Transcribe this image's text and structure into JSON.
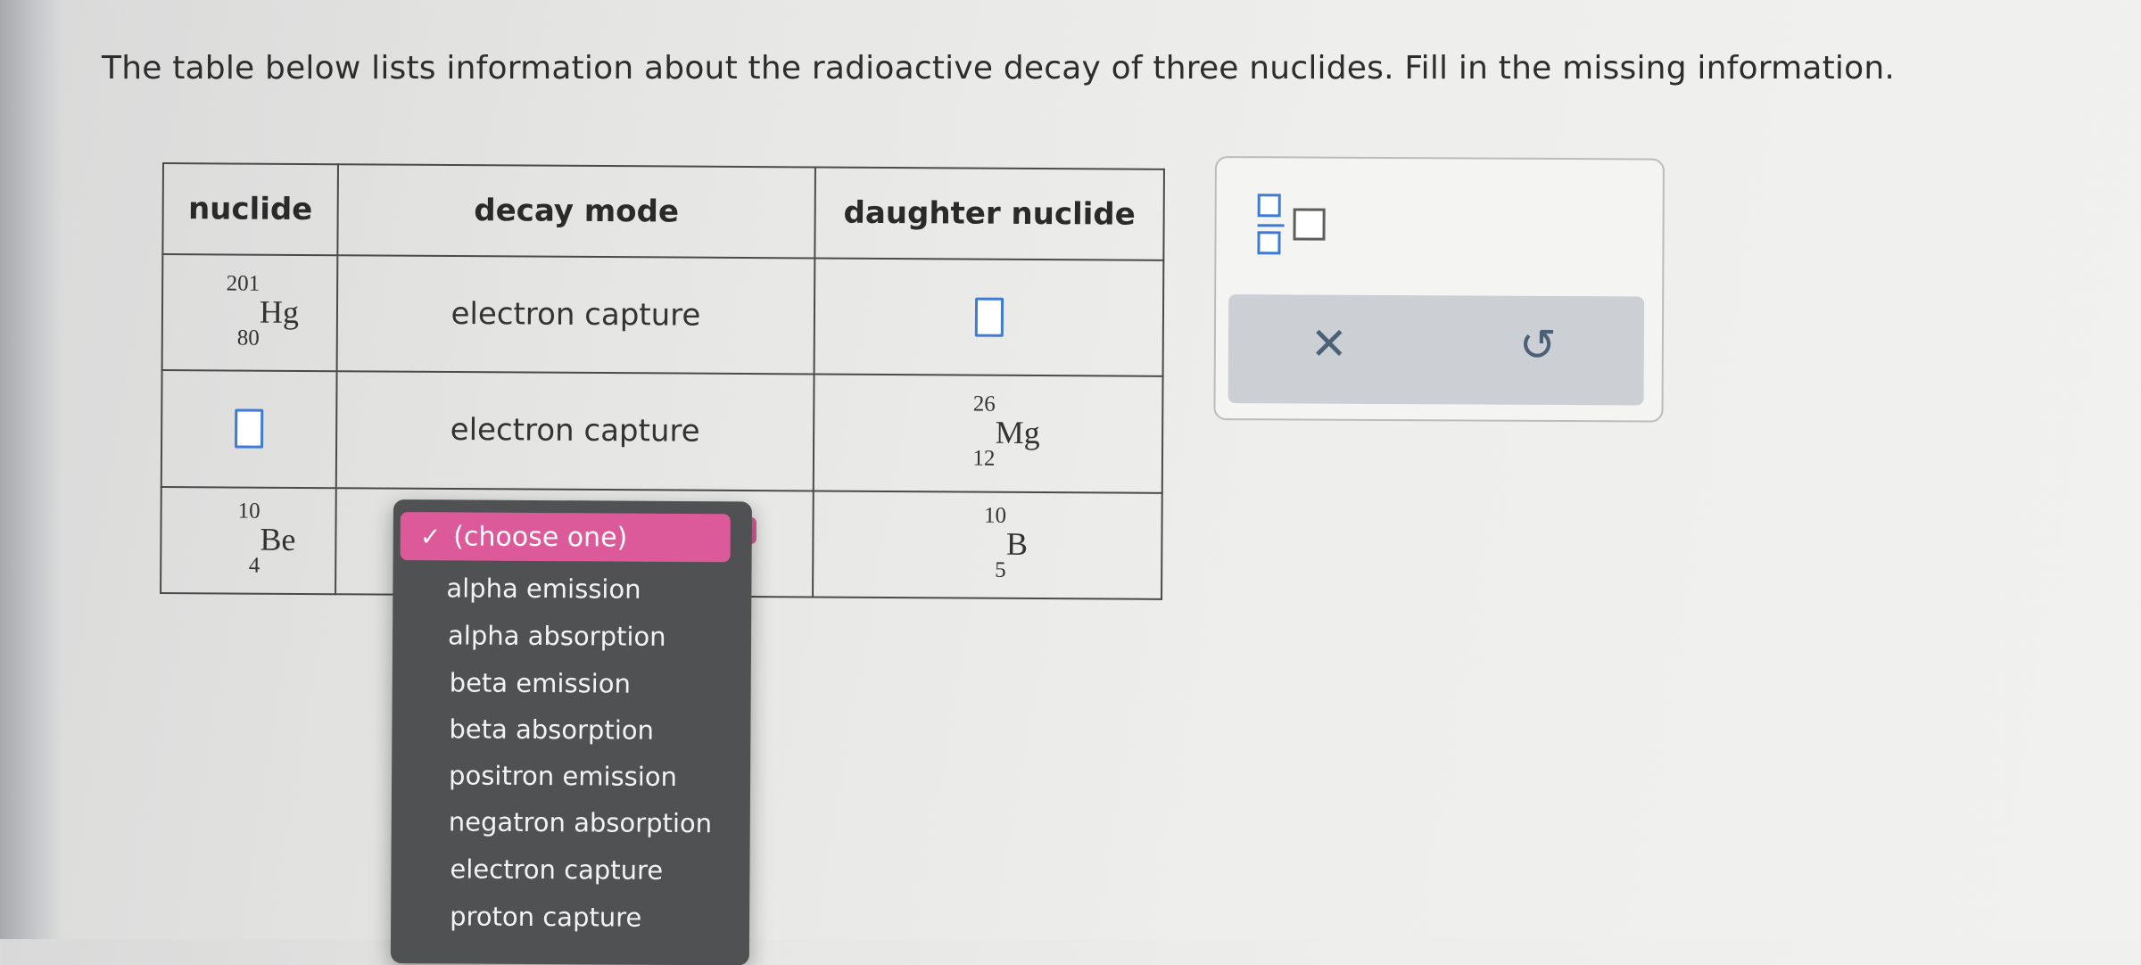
{
  "question": "The table below lists information about the radioactive decay of three nuclides. Fill in the missing information.",
  "table": {
    "headers": [
      "nuclide",
      "decay mode",
      "daughter nuclide"
    ],
    "rows": [
      {
        "nuclide": {
          "mass": "201",
          "atomic": "80",
          "symbol": "Hg"
        },
        "decay_mode": "electron capture",
        "daughter": {
          "empty_box": true
        }
      },
      {
        "nuclide": {
          "empty_box": true
        },
        "decay_mode": "electron capture",
        "daughter": {
          "mass": "26",
          "atomic": "12",
          "symbol": "Mg"
        }
      },
      {
        "nuclide": {
          "mass": "10",
          "atomic": "4",
          "symbol": "Be"
        },
        "decay_mode": "(choose one)",
        "daughter": {
          "mass": "10",
          "atomic": "5",
          "symbol": "B"
        }
      }
    ]
  },
  "dropdown": {
    "selected": "(choose one)",
    "check_icon": "checkmark-icon",
    "options": [
      "alpha emission",
      "alpha absorption",
      "beta emission",
      "beta absorption",
      "positron emission",
      "negatron absorption",
      "electron capture",
      "proton capture"
    ]
  },
  "answer_panel": {
    "fraction_tool_icon": "fraction-box-icon",
    "clear_icon": "x-icon",
    "undo_icon": "undo-icon",
    "clear_glyph": "✕",
    "undo_glyph": "↺"
  },
  "colors": {
    "accent_blue": "#3d7bd6",
    "dropdown_highlight": "#dd5a9a",
    "dropdown_bg": "#505152"
  }
}
